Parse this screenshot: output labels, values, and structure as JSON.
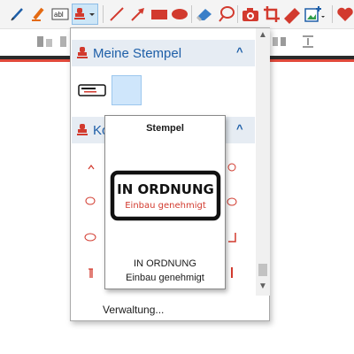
{
  "toolbar": {
    "icons": [
      "pen-icon",
      "highlighter-icon",
      "text-field-icon",
      "stamp-icon",
      "line-icon",
      "arrow-icon",
      "rectangle-icon",
      "ellipse-icon",
      "eraser-icon",
      "lasso-icon",
      "camera-icon",
      "crop-icon",
      "ruler-icon",
      "image-insert-icon",
      "heart-icon"
    ]
  },
  "panel": {
    "section_my_stamps": "Meine Stempel",
    "section_second_partial": "Ko",
    "footer_link": "Verwaltung..."
  },
  "tooltip": {
    "title": "Stempel",
    "stamp_main": "IN ORDNUNG",
    "stamp_sub": "Einbau genehmigt",
    "name": "IN ORDNUNG",
    "description": "Einbau genehmigt"
  },
  "colors": {
    "accent_red": "#d23a2e",
    "accent_blue": "#1e5fa8",
    "active_bg": "#cde6f7"
  }
}
